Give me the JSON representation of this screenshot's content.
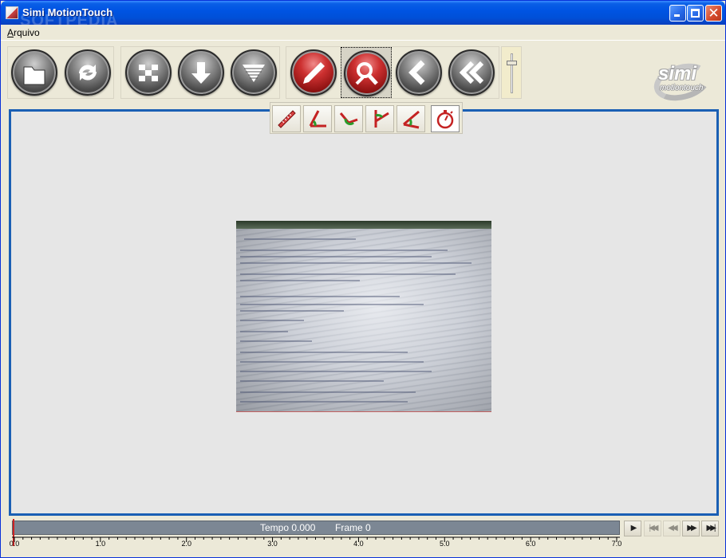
{
  "window": {
    "title": "Simi MotionTouch",
    "watermark": "SOFTPEDIA",
    "controls": {
      "minimize_icon": "minimize-icon",
      "maximize_icon": "maximize-icon",
      "close_icon": "close-icon"
    }
  },
  "menubar": {
    "items": [
      {
        "label": "Arquivo"
      }
    ]
  },
  "toolbar": {
    "buttons": [
      {
        "name": "open-button",
        "icon": "folder-icon",
        "color": "gray"
      },
      {
        "name": "refresh-button",
        "icon": "refresh-icon",
        "color": "gray"
      },
      {
        "name": "checker-button",
        "icon": "checker-icon",
        "color": "gray"
      },
      {
        "name": "download-button",
        "icon": "download-icon",
        "color": "gray"
      },
      {
        "name": "filter-button",
        "icon": "funnel-icon",
        "color": "gray"
      },
      {
        "name": "draw-button",
        "icon": "pen-icon",
        "color": "red"
      },
      {
        "name": "measure-button",
        "icon": "magnifier-icon",
        "color": "red",
        "selected": true
      },
      {
        "name": "back-button",
        "icon": "chevron-left-icon",
        "color": "gray"
      },
      {
        "name": "rewind-button",
        "icon": "double-chevron-left-icon",
        "color": "gray"
      }
    ],
    "slider_level": 0.2
  },
  "logo": {
    "main": "simi",
    "sub": "motiontouch"
  },
  "measure_tools": [
    {
      "icon": "ruler-icon"
    },
    {
      "icon": "angle-icon"
    },
    {
      "icon": "angle-arc-icon"
    },
    {
      "icon": "angle-vertical-icon"
    },
    {
      "icon": "angle-open-icon"
    },
    {
      "icon": "stopwatch-icon",
      "active": true
    }
  ],
  "timeline": {
    "tempo_text": "Tempo 0.000",
    "frame_text": "Frame 0",
    "ticks": [
      "0.0",
      "1.0",
      "2.0",
      "3.0",
      "4.0",
      "5.0",
      "6.0",
      "7.0"
    ],
    "range": [
      0,
      7
    ],
    "cursor": 0
  },
  "playback": [
    {
      "icon": "play-icon",
      "glyph": "▶",
      "enabled": true
    },
    {
      "icon": "skip-start-icon",
      "glyph": "|◀◀",
      "enabled": false
    },
    {
      "icon": "step-back-icon",
      "glyph": "◀◀",
      "enabled": false
    },
    {
      "icon": "fast-forward-icon",
      "glyph": "▶▶",
      "enabled": true
    },
    {
      "icon": "skip-end-icon",
      "glyph": "▶▶|",
      "enabled": true
    }
  ],
  "colors": {
    "accent_blue": "#1a5fb4",
    "titlebar": "#0054e3",
    "timeline": "#7c8794"
  }
}
